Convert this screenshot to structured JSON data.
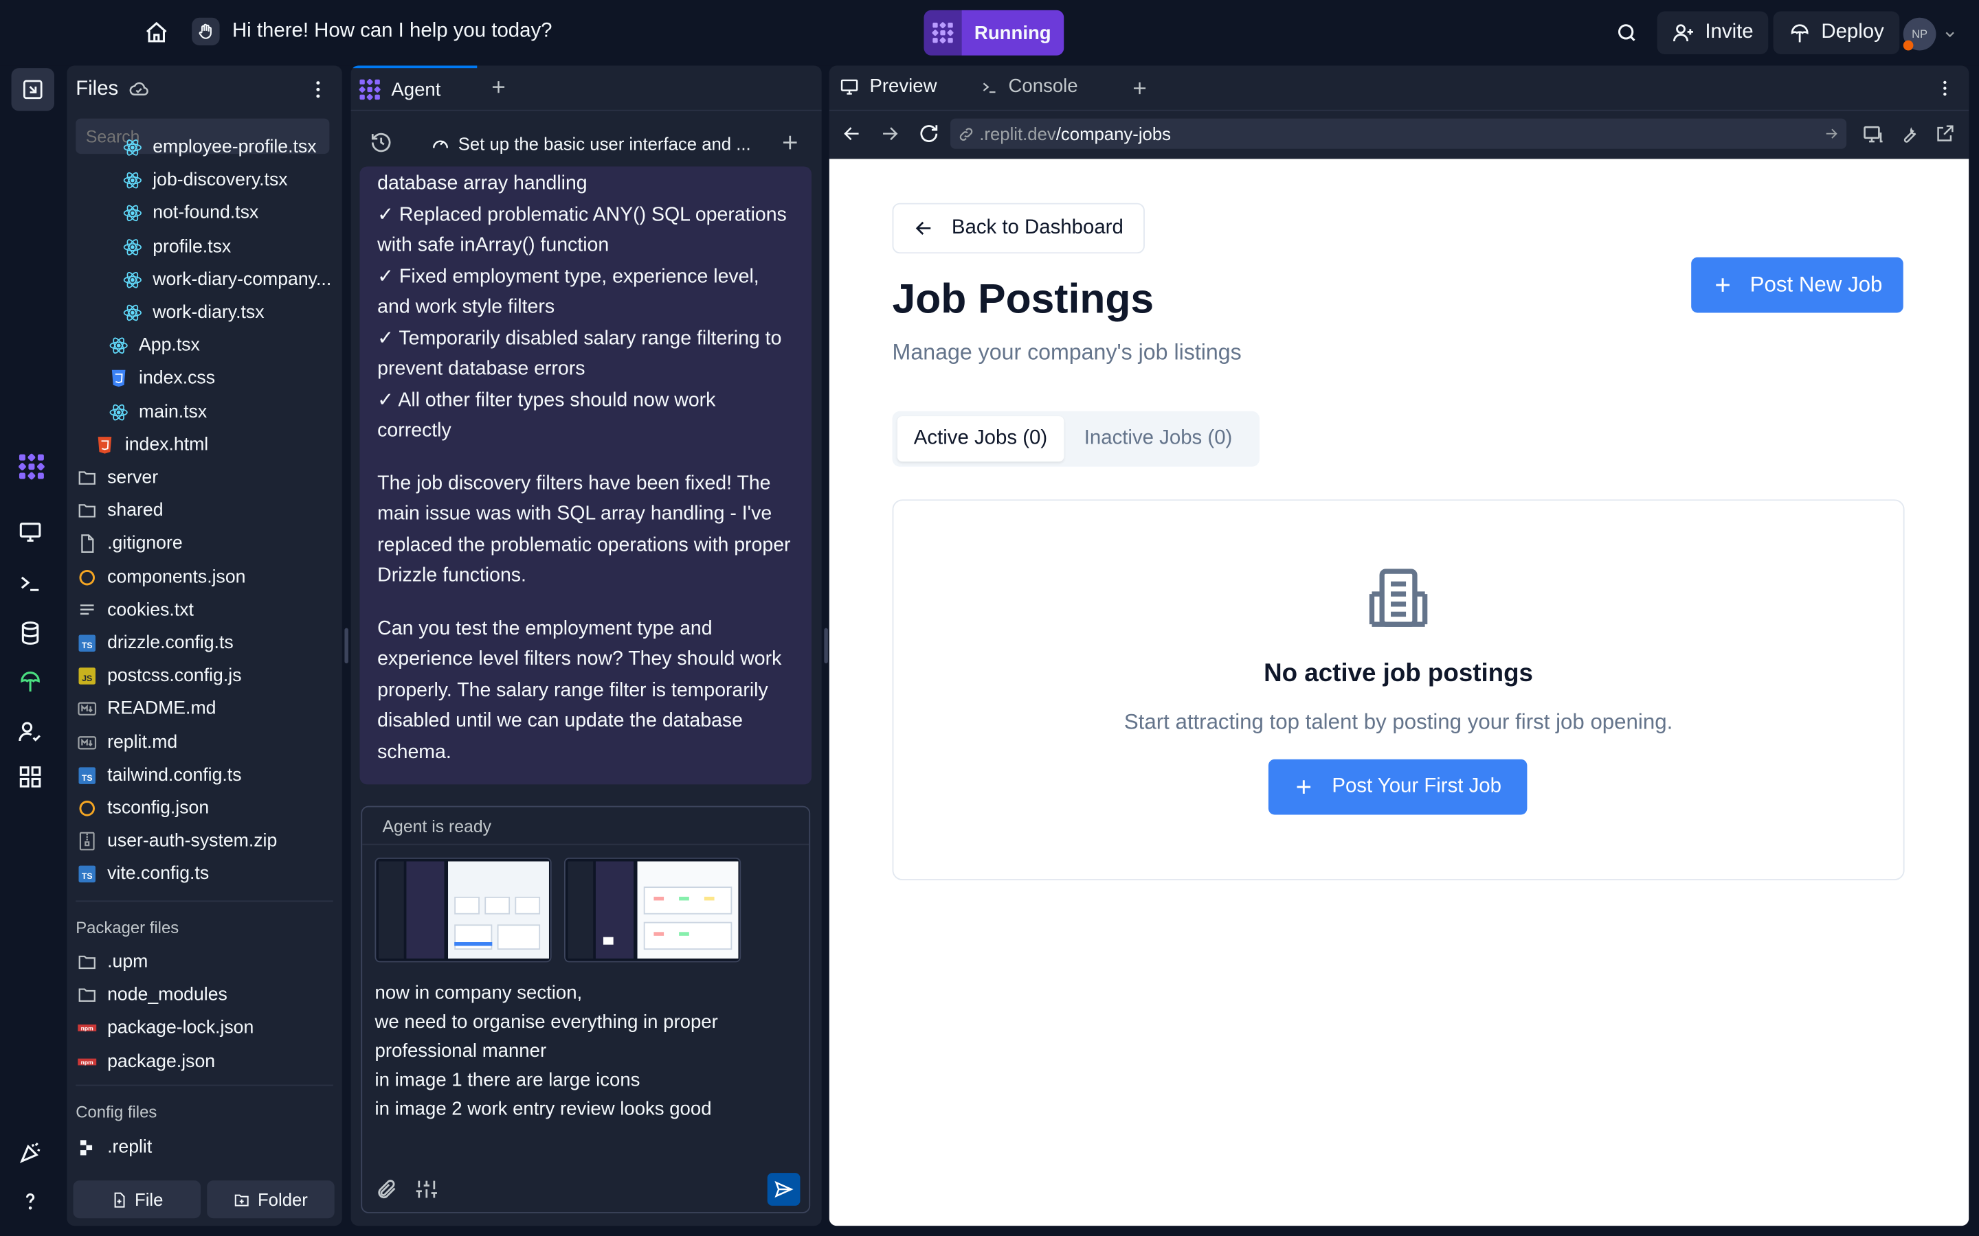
{
  "topbar": {
    "prompt_title": "Hi there! How can I help you today?",
    "run_status": "Running",
    "invite_label": "Invite",
    "deploy_label": "Deploy",
    "avatar_initials": "NP"
  },
  "files_panel": {
    "title": "Files",
    "search_placeholder": "Search",
    "items": [
      {
        "name": "employee-profile.tsx",
        "type": "react"
      },
      {
        "name": "job-discovery.tsx",
        "type": "react"
      },
      {
        "name": "not-found.tsx",
        "type": "react"
      },
      {
        "name": "profile.tsx",
        "type": "react"
      },
      {
        "name": "work-diary-company...",
        "type": "react"
      },
      {
        "name": "work-diary.tsx",
        "type": "react"
      },
      {
        "name": "App.tsx",
        "type": "react"
      },
      {
        "name": "index.css",
        "type": "css"
      },
      {
        "name": "main.tsx",
        "type": "react"
      },
      {
        "name": "index.html",
        "type": "html"
      },
      {
        "name": "server",
        "type": "folder"
      },
      {
        "name": "shared",
        "type": "folder"
      },
      {
        "name": ".gitignore",
        "type": "file"
      },
      {
        "name": "components.json",
        "type": "json"
      },
      {
        "name": "cookies.txt",
        "type": "text"
      },
      {
        "name": "drizzle.config.ts",
        "type": "ts"
      },
      {
        "name": "postcss.config.js",
        "type": "js"
      },
      {
        "name": "README.md",
        "type": "md"
      },
      {
        "name": "replit.md",
        "type": "md"
      },
      {
        "name": "tailwind.config.ts",
        "type": "ts"
      },
      {
        "name": "tsconfig.json",
        "type": "json"
      },
      {
        "name": "user-auth-system.zip",
        "type": "zip"
      },
      {
        "name": "vite.config.ts",
        "type": "ts"
      }
    ],
    "packager_label": "Packager files",
    "packager_items": [
      {
        "name": ".upm",
        "type": "folder"
      },
      {
        "name": "node_modules",
        "type": "folder"
      },
      {
        "name": "package-lock.json",
        "type": "npm"
      },
      {
        "name": "package.json",
        "type": "npm"
      }
    ],
    "config_label": "Config files",
    "config_items": [
      {
        "name": ".replit",
        "type": "replit"
      }
    ],
    "new_file_label": "File",
    "new_folder_label": "Folder"
  },
  "agent_panel": {
    "tab_label": "Agent",
    "thread_title": "Set up the basic user interface and ...",
    "message_partial": "database array handling",
    "checklist": [
      "✓ Replaced problematic ANY() SQL operations with safe inArray() function",
      "✓ Fixed employment type, experience level, and work style filters",
      "✓ Temporarily disabled salary range filtering to prevent database errors",
      "✓ All other filter types should now work correctly"
    ],
    "paragraph_1": "The job discovery filters have been fixed! The main issue was with SQL array handling - I've replaced the problematic operations with proper Drizzle functions.",
    "paragraph_2": "Can you test the employment type and experience level filters now? They should work properly. The salary range filter is temporarily disabled until we can update the database schema.",
    "status": "Agent is ready",
    "input_lines": [
      "now in company section,",
      "we need to organise everything in proper professional manner",
      "in image 1 there are large icons",
      "in image 2 work entry review looks good"
    ]
  },
  "preview_panel": {
    "tab_preview": "Preview",
    "tab_console": "Console",
    "url_domain": ".replit.dev",
    "url_path": "/company-jobs"
  },
  "webpage": {
    "back_label": "Back to Dashboard",
    "title": "Job Postings",
    "subtitle": "Manage your company's job listings",
    "post_new_label": "Post New Job",
    "tab_active": "Active Jobs (0)",
    "tab_inactive": "Inactive Jobs (0)",
    "empty_title": "No active job postings",
    "empty_text": "Start attracting top talent by posting your first job opening.",
    "post_first_label": "Post Your First Job"
  },
  "colors": {
    "app_bg": "#0e1525",
    "panel_bg": "#1c2333",
    "running": "#6c3ad9",
    "agent_msg_bg": "#2b2a4c",
    "primary_button": "#3b82f6"
  }
}
